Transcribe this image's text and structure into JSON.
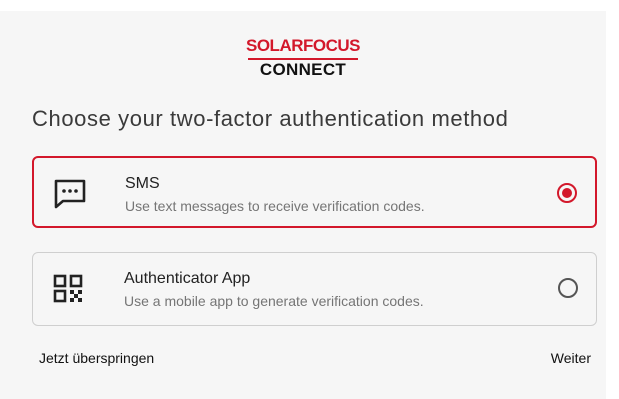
{
  "logo": {
    "brand": "SOLARFOCUS",
    "product": "CONNECT"
  },
  "page_title": "Choose your two-factor authentication method",
  "options": [
    {
      "label": "SMS",
      "description": "Use text messages to receive verification codes.",
      "selected": true,
      "icon": "message-icon"
    },
    {
      "label": "Authenticator App",
      "description": "Use a mobile app to generate verification codes.",
      "selected": false,
      "icon": "qr-code-icon"
    }
  ],
  "footer": {
    "skip_label": "Jetzt überspringen",
    "next_label": "Weiter"
  },
  "colors": {
    "accent": "#d3182b",
    "card_bg": "#f6f6f6",
    "border": "#cfcfcf"
  }
}
